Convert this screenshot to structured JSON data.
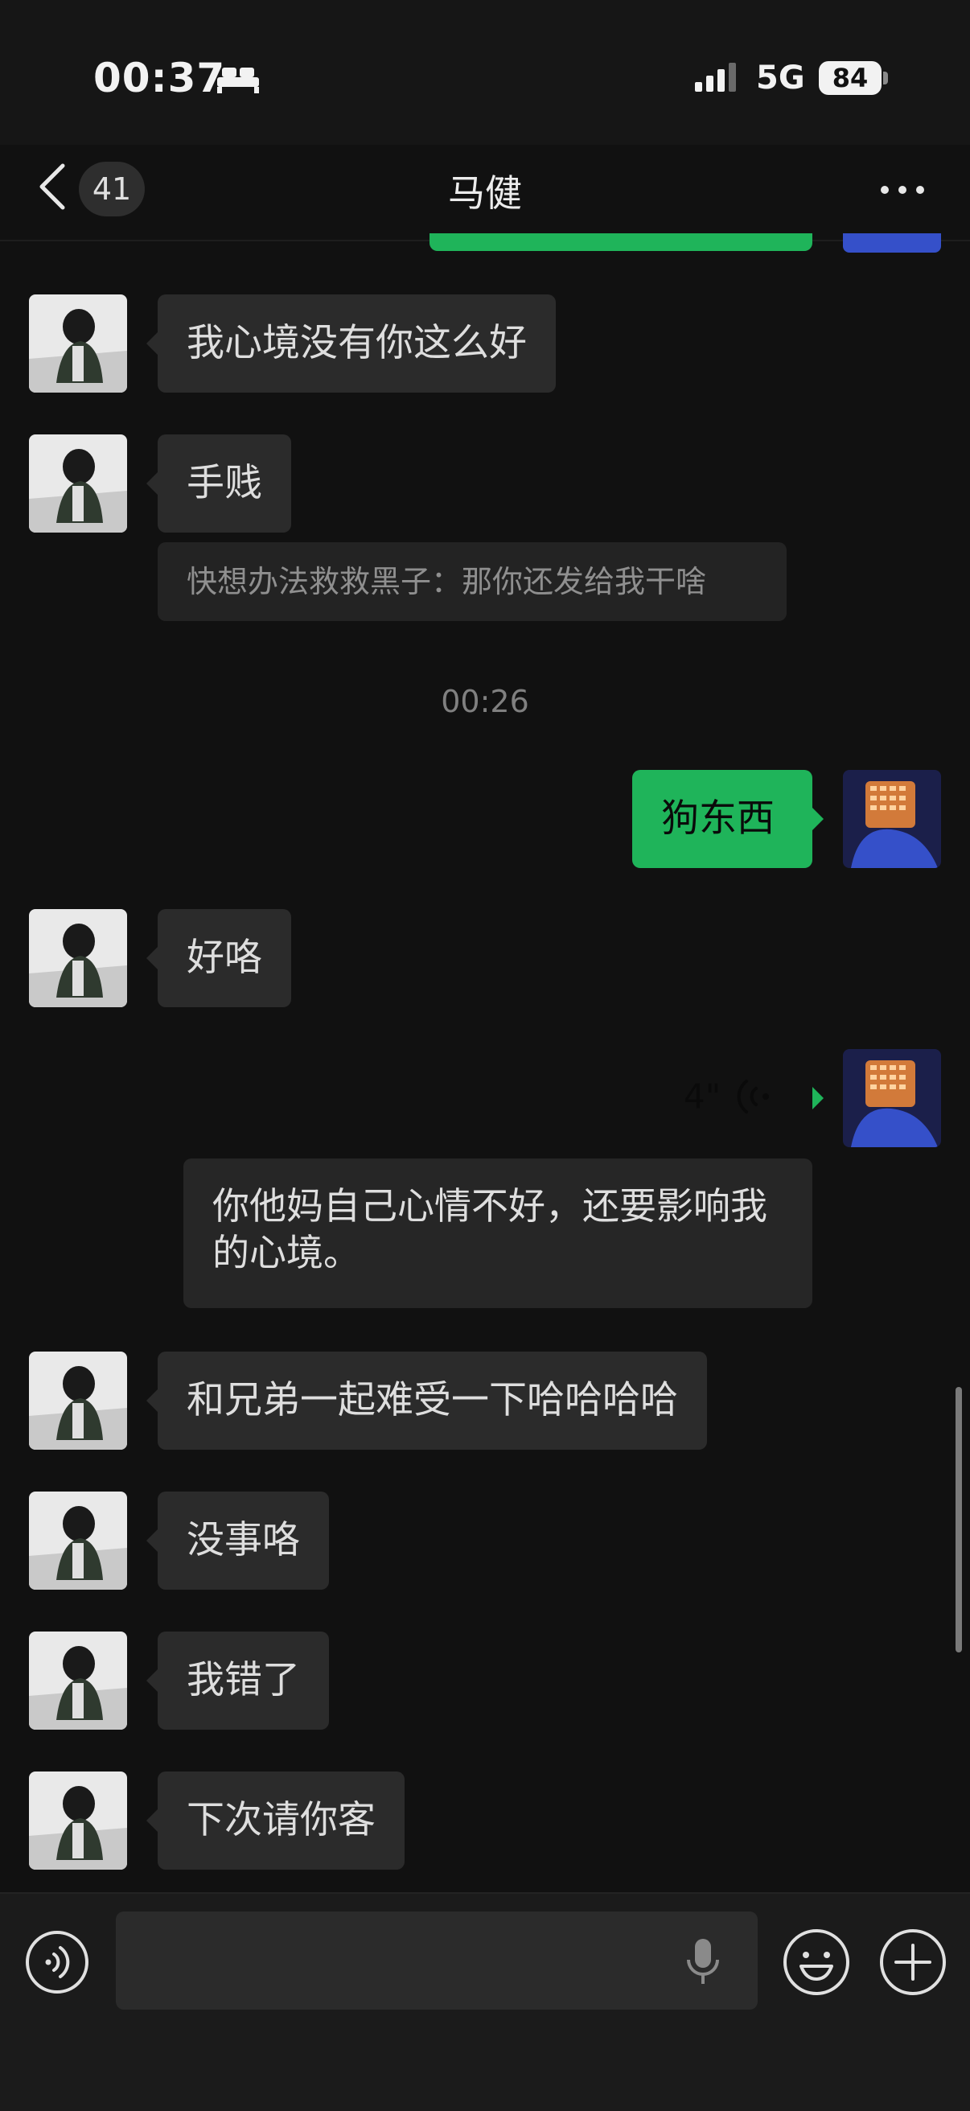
{
  "status_bar": {
    "time": "00:37",
    "network": "5G",
    "battery": "84"
  },
  "header": {
    "unread_count": "41",
    "title": "马健"
  },
  "messages": [
    {
      "side": "in",
      "text": "我心境没有你这么好"
    },
    {
      "side": "in",
      "text": "手贱"
    },
    {
      "side": "in",
      "text": "好咯"
    },
    {
      "side": "in",
      "text": "和兄弟一起难受一下哈哈哈哈"
    },
    {
      "side": "in",
      "text": "没事咯"
    },
    {
      "side": "in",
      "text": "我错了"
    },
    {
      "side": "in",
      "text": "下次请你客"
    }
  ],
  "outgoing": {
    "text": "狗东西"
  },
  "quote": {
    "text": "快想办法救救黑子：那你还发给我干啥"
  },
  "timestamp": "00:26",
  "voice_message": {
    "duration": "4\"",
    "transcript": "你他妈自己心情不好，还要影响我的心境。"
  },
  "colors": {
    "background": "#111111",
    "incoming_bubble": "#2b2b2b",
    "outgoing_bubble": "#1fb45a"
  }
}
